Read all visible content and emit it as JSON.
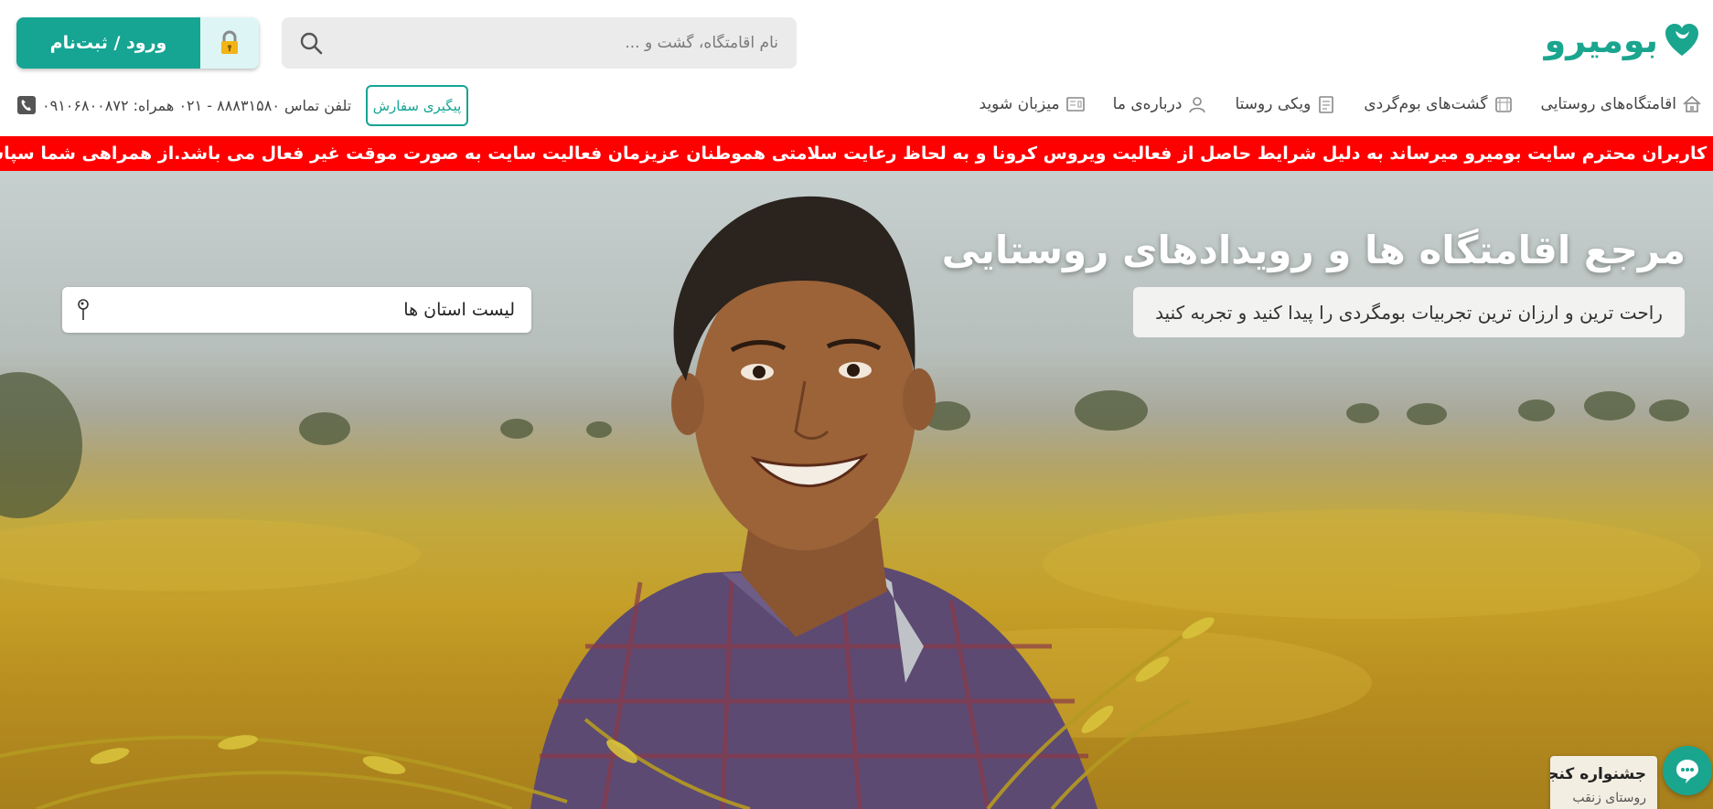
{
  "header": {
    "logo_text": "بومیرو",
    "search": {
      "placeholder": "نام اقامتگاه، گشت و ..."
    },
    "login_label": "ورود / ثبت‌نام"
  },
  "nav": {
    "items": [
      {
        "label": "اقامتگاه‌های روستایی",
        "icon": "house-icon"
      },
      {
        "label": "گشت‌های بوم‌گردی",
        "icon": "tour-icon"
      },
      {
        "label": "ویکی روستا",
        "icon": "wiki-icon"
      },
      {
        "label": "درباره‌ی ما",
        "icon": "about-icon"
      },
      {
        "label": "میزبان شوید",
        "icon": "host-icon"
      }
    ],
    "track_order_label": "پیگیری سفارش",
    "contact_text": "تلفن تماس ۸۸۸۳۱۵۸۰ - ۰۲۱ همراه: ۰۹۱۰۶۸۰۰۸۷۲"
  },
  "banner": {
    "text": "به اطلاع کاربران محترم سایت بومیرو میرساند به دلیل شرایط حاصل از فعالیت ویروس کرونا و به لحاظ رعایت سلامتی هموطنان عزیزمان فعالیت سایت به صورت موقت غیر فعال می باشد.از همراهی شما سپاسگزاریم"
  },
  "hero": {
    "title": "مرجع اقامتگاه ها و رویدادهای روستایی",
    "subtitle": "راحت ترین و ارزان ترین تجربیات بومگردی را پیدا کنید و تجربه کنید",
    "province_select_label": "لیست استان ها",
    "festival_title": "جشنواره کنجد",
    "festival_sub": "روستای زنقب"
  },
  "colors": {
    "brand": "#1aa58f",
    "login_bg": "#16a493",
    "banner_bg": "#ff0000",
    "search_bg": "#ebebeb"
  }
}
